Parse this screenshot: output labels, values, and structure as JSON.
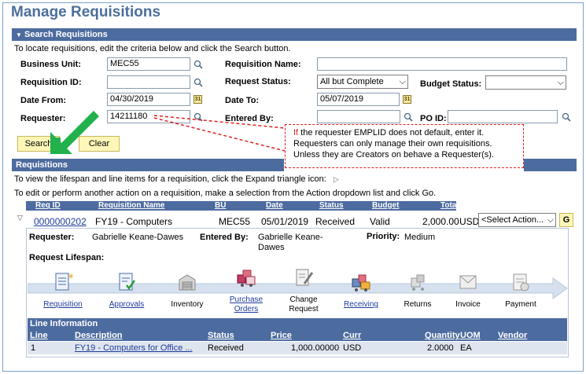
{
  "page_title": "Manage Requisitions",
  "search_section": {
    "header": "Search Requisitions",
    "instructions": "To locate requisitions, edit the criteria below and click the Search button.",
    "business_unit": {
      "label": "Business Unit:",
      "value": "MEC55"
    },
    "requisition_name": {
      "label": "Requisition Name:",
      "value": ""
    },
    "requisition_id": {
      "label": "Requisition ID:",
      "value": ""
    },
    "request_status": {
      "label": "Request Status:",
      "value": "All but Complete"
    },
    "budget_status": {
      "label": "Budget Status:",
      "value": ""
    },
    "date_from": {
      "label": "Date From:",
      "value": "04/30/2019"
    },
    "date_to": {
      "label": "Date To:",
      "value": "05/07/2019"
    },
    "requester": {
      "label": "Requester:",
      "value": "14211180"
    },
    "entered_by": {
      "label": "Entered By:",
      "value": ""
    },
    "po_id": {
      "label": "PO ID:",
      "value": ""
    },
    "search_label": "Search",
    "clear_label": "Clear"
  },
  "callout": {
    "line1_red": "If",
    "line1_rest": " the requester EMPLID does not default, enter it.",
    "line2": "Requesters can only manage their own requisitions.",
    "line3": "Unless they are Creators on behave a Requester(s)."
  },
  "requisitions_section": {
    "header": "Requisitions",
    "instr1": "To view the lifespan and line items for a requisition, click the Expand triangle icon:",
    "instr2": "To edit or perform another action on a requisition, make a selection from the Action dropdown list and click Go.",
    "columns": [
      "Req ID",
      "Requisition Name",
      "BU",
      "Date",
      "Status",
      "Budget",
      "Total"
    ],
    "row": {
      "req_id": "0000000202",
      "name": "FY19 - Computers",
      "bu": "MEC55",
      "date": "05/01/2019",
      "status": "Received",
      "budget": "Valid",
      "total": "2,000.00",
      "currency": "USD",
      "action": "<Select Action...",
      "go": "G"
    },
    "detail": {
      "requester_label": "Requester:",
      "requester_value": "Gabrielle Keane-Dawes",
      "entered_by_label": "Entered By:",
      "entered_by_value_1": "Gabrielle Keane-",
      "entered_by_value_2": "Dawes",
      "priority_label": "Priority:",
      "priority_value": "Medium",
      "lifespan_label": "Request Lifespan:"
    },
    "lifespan": [
      {
        "label": "Requisition",
        "icon": "requisition-icon",
        "link": true
      },
      {
        "label": "Approvals",
        "icon": "approvals-icon",
        "link": true
      },
      {
        "label": "Inventory",
        "icon": "inventory-icon",
        "link": false
      },
      {
        "label1": "Purchase",
        "label2": "Orders",
        "icon": "purchase-orders-icon",
        "link": true
      },
      {
        "label1": "Change",
        "label2": "Request",
        "icon": "change-request-icon",
        "link": false
      },
      {
        "label": "Receiving",
        "icon": "receiving-icon",
        "link": true
      },
      {
        "label": "Returns",
        "icon": "returns-icon",
        "link": false
      },
      {
        "label": "Invoice",
        "icon": "invoice-icon",
        "link": false
      },
      {
        "label": "Payment",
        "icon": "payment-icon",
        "link": false
      }
    ],
    "line_info": {
      "header": "Line Information",
      "columns": [
        "Line",
        "Description",
        "Status",
        "Price",
        "Curr",
        "Quantity",
        "UOM",
        "Vendor"
      ],
      "row": {
        "line": "1",
        "description": "FY19 - Computers for Office ...",
        "status": "Received",
        "price": "1,000.00000",
        "curr": "USD",
        "quantity": "2.0000",
        "uom": "EA",
        "vendor": ""
      }
    }
  },
  "colors": {
    "accent": "#4c6b9f",
    "title": "#4c6f9b",
    "callout_border": "#e02020",
    "arrow": "#22b14c"
  }
}
